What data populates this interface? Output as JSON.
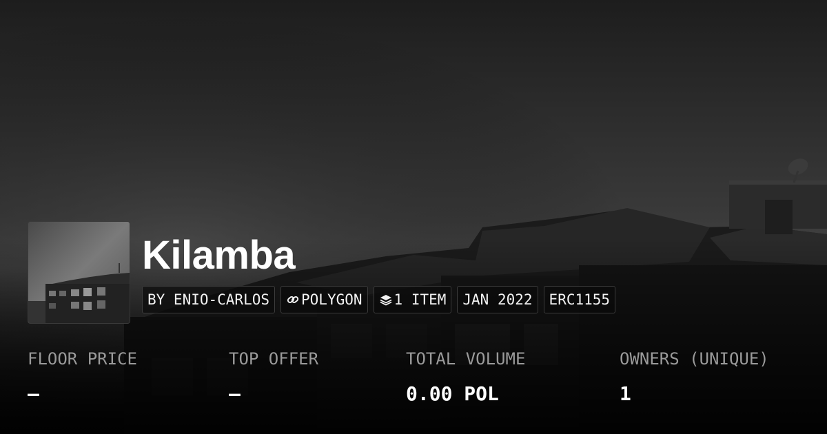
{
  "collection": {
    "name": "Kilamba",
    "chips": [
      {
        "text": "BY ENIO-CARLOS",
        "icon": ""
      },
      {
        "text": "POLYGON",
        "icon": "chain-link-icon"
      },
      {
        "text": "1 ITEM",
        "icon": "layers-icon"
      },
      {
        "text": "JAN 2022",
        "icon": ""
      },
      {
        "text": "ERC1155",
        "icon": ""
      }
    ]
  },
  "stats": [
    {
      "label": "FLOOR PRICE",
      "value": "—"
    },
    {
      "label": "TOP OFFER",
      "value": "—"
    },
    {
      "label": "TOTAL VOLUME",
      "value": "0.00 POL"
    },
    {
      "label": "OWNERS (UNIQUE)",
      "value": "1"
    }
  ],
  "colors": {
    "background": "#0a0a0a",
    "text": "#ffffff",
    "muted": "#9a9a9a",
    "chip_border": "#3c3c3c"
  }
}
